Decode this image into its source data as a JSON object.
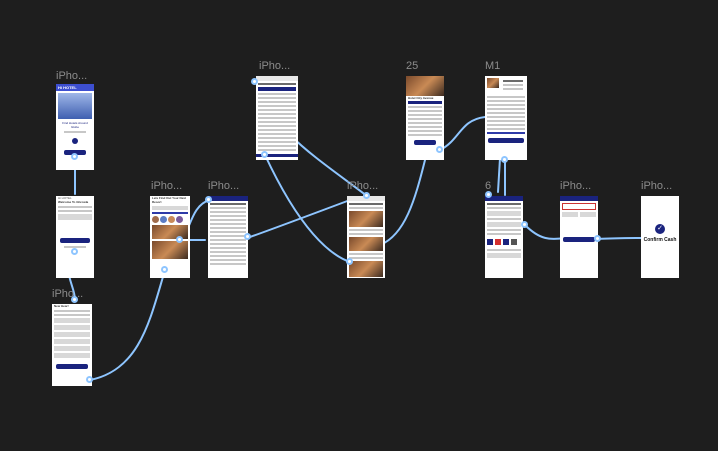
{
  "canvas": {
    "background": "#1e1e1e",
    "wire_color": "#8ec5ff"
  },
  "frames": [
    {
      "id": "splash",
      "label": "iPho..."
    },
    {
      "id": "welcome",
      "label": ""
    },
    {
      "id": "signup",
      "label": "iPho..."
    },
    {
      "id": "home",
      "label": "iPho..."
    },
    {
      "id": "city-list",
      "label": "iPho..."
    },
    {
      "id": "location",
      "label": "iPho..."
    },
    {
      "id": "hotel-list",
      "label": "iPho..."
    },
    {
      "id": "hotel-detail",
      "label": "25"
    },
    {
      "id": "booking",
      "label": "M1"
    },
    {
      "id": "payment",
      "label": "6"
    },
    {
      "id": "add-card",
      "label": "iPho..."
    },
    {
      "id": "confirm",
      "label": "iPho..."
    }
  ],
  "splash": {
    "brand": "Hi HOTEL",
    "tagline": "Find Hotels Around Globe"
  },
  "welcome": {
    "brand": "Hi HOTEL",
    "title": "Welcome To Ghrowla"
  },
  "signup": {
    "title": "New Hear!"
  },
  "home": {
    "title": "Lets Find Out Your Next Resort"
  },
  "hotel_detail": {
    "name": "Hotel City Avenue"
  },
  "confirm": {
    "text": "Confirm Cash"
  }
}
